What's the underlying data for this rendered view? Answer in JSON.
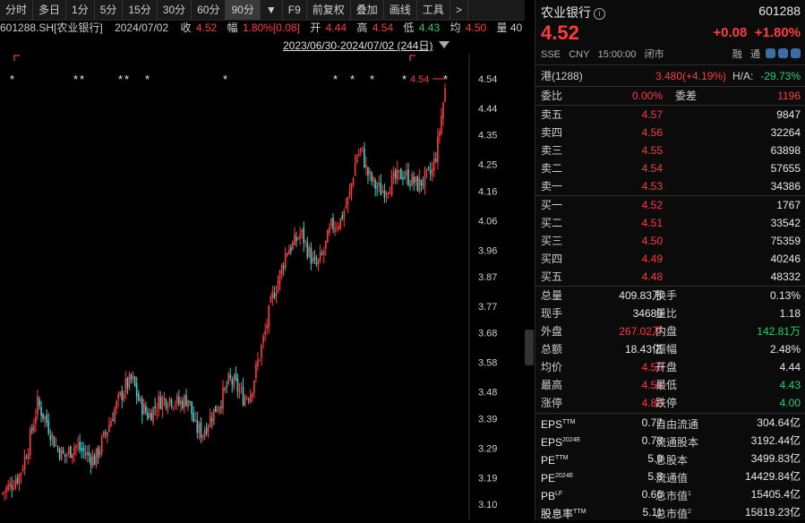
{
  "toolbar": {
    "buttons": [
      "分时",
      "多日",
      "1分",
      "5分",
      "15分",
      "30分",
      "60分",
      "90分"
    ],
    "dropdown": "▼",
    "right_buttons": [
      "F9",
      "前复权",
      "叠加",
      "画线",
      "工具",
      ">"
    ]
  },
  "infobar": {
    "code": "601288.SH[农业银行]",
    "date": "2024/07/02",
    "close_label": "收",
    "close": "4.52",
    "amp_label": "幅",
    "amp": "1.80%[0.08]",
    "open_label": "开",
    "open": "4.44",
    "high_label": "高",
    "high": "4.54",
    "low_label": "低",
    "low": "4.43",
    "avg_label": "均",
    "avg": "4.50",
    "extra": "量 40"
  },
  "daterange": "2023/06/30-2024/07/02 (244日)",
  "chart_data": {
    "type": "candlestick",
    "yticks": [
      "4.54",
      "4.44",
      "4.35",
      "4.25",
      "4.16",
      "4.06",
      "3.96",
      "3.87",
      "3.77",
      "3.68",
      "3.58",
      "3.48",
      "3.39",
      "3.29",
      "3.19",
      "3.10"
    ],
    "ymin": 3.1,
    "ymax": 4.54,
    "max_label": "4.54",
    "markers": "*",
    "up_color": "#ff3b3b",
    "down_color": "#3ad0c8"
  },
  "panel": {
    "name": "农业银行",
    "info_icon": "i",
    "code": "601288",
    "price": "4.52",
    "change": "+0.08",
    "change_pct": "+1.80%",
    "exchange": "SSE",
    "currency": "CNY",
    "time": "15:00:00",
    "status": "闭市",
    "rong": "融",
    "tong": "通",
    "hk_label": "港(1288)",
    "hk_price": "3.480(+4.19%)",
    "ha_label": "H/A:",
    "ha_value": "-29.73%",
    "weibi_label": "委比",
    "weibi": "0.00%",
    "weicha_label": "委差",
    "weicha": "1196",
    "asks": [
      {
        "label": "卖五",
        "price": "4.57",
        "vol": "9847"
      },
      {
        "label": "卖四",
        "price": "4.56",
        "vol": "32264"
      },
      {
        "label": "卖三",
        "price": "4.55",
        "vol": "63898"
      },
      {
        "label": "卖二",
        "price": "4.54",
        "vol": "57655"
      },
      {
        "label": "卖一",
        "price": "4.53",
        "vol": "34386"
      }
    ],
    "bids": [
      {
        "label": "买一",
        "price": "4.52",
        "vol": "1767"
      },
      {
        "label": "买二",
        "price": "4.51",
        "vol": "33542"
      },
      {
        "label": "买三",
        "price": "4.50",
        "vol": "75359"
      },
      {
        "label": "买四",
        "price": "4.49",
        "vol": "40246"
      },
      {
        "label": "买五",
        "price": "4.48",
        "vol": "48332"
      }
    ],
    "stats": [
      {
        "l1": "总量",
        "v1": "409.83万",
        "c1": "white",
        "l2": "换手",
        "v2": "0.13%",
        "c2": "white"
      },
      {
        "l1": "现手",
        "v1": "34680",
        "c1": "white",
        "l2": "量比",
        "v2": "1.18",
        "c2": "white"
      },
      {
        "l1": "外盘",
        "v1": "267.02万",
        "c1": "red",
        "l2": "内盘",
        "v2": "142.81万",
        "c2": "green"
      },
      {
        "l1": "总额",
        "v1": "18.43亿",
        "c1": "white",
        "l2": "振幅",
        "v2": "2.48%",
        "c2": "white"
      },
      {
        "l1": "均价",
        "v1": "4.50",
        "c1": "red",
        "l2": "开盘",
        "v2": "4.44",
        "c2": "white"
      },
      {
        "l1": "最高",
        "v1": "4.54",
        "c1": "red",
        "l2": "最低",
        "v2": "4.43",
        "c2": "green"
      },
      {
        "l1": "涨停",
        "v1": "4.88",
        "c1": "red",
        "l2": "跌停",
        "v2": "4.00",
        "c2": "green"
      }
    ],
    "fin": [
      {
        "l1": "EPS",
        "s1": "TTM",
        "v1": "0.77",
        "l2": "自由流通",
        "s2": "",
        "v2": "304.64亿"
      },
      {
        "l1": "EPS",
        "s1": "2024E",
        "v1": "0.78",
        "l2": "流通股本",
        "s2": "",
        "v2": "3192.44亿"
      },
      {
        "l1": "PE",
        "s1": "TTM",
        "v1": "5.9",
        "l2": "总股本",
        "s2": "",
        "v2": "3499.83亿"
      },
      {
        "l1": "PE",
        "s1": "2024E",
        "v1": "5.8",
        "l2": "流通值",
        "s2": "",
        "v2": "14429.84亿"
      },
      {
        "l1": "PB",
        "s1": "LF",
        "v1": "0.66",
        "l2": "总市值",
        "s2": "1",
        "v2": "15405.4亿"
      },
      {
        "l1": "股息率",
        "s1": "TTM",
        "v1": "5.11",
        "l2": "总市值",
        "s2": "2",
        "v2": "15819.23亿"
      }
    ]
  }
}
